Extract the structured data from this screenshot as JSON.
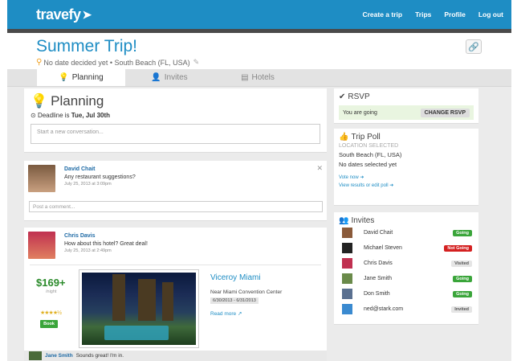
{
  "app": {
    "logo": "travefy"
  },
  "nav": {
    "items": [
      "Create a trip",
      "Trips",
      "Profile",
      "Log out"
    ]
  },
  "trip": {
    "title": "Summer Trip!",
    "subtitle": "No date decided yet • South Beach (FL, USA)"
  },
  "tabs": [
    "Planning",
    "Invites",
    "Hotels"
  ],
  "planning": {
    "heading": "Planning",
    "deadline_prefix": "Deadline is ",
    "deadline": "Tue, Jul 30th",
    "convo_placeholder": "Start a new conversation..."
  },
  "post1": {
    "author": "David Chait",
    "text": "Any restaurant suggestions?",
    "date": "July 25, 2013 at 3:09pm",
    "comment_placeholder": "Post a comment..."
  },
  "post2": {
    "author": "Chris Davis",
    "text": "How about this hotel? Great deal!",
    "date": "July 25, 2013 at 2:49pm"
  },
  "hotel": {
    "price": "$169+",
    "per": "/night",
    "stars": "★★★★½",
    "book": "Book",
    "name": "Viceroy Miami",
    "near": "Near Miami Convention Center",
    "dates": "6/30/2013 - 6/31/2013",
    "more": "Read more"
  },
  "reply": {
    "author": "Jane Smith",
    "text": "Sounds great! I'm in."
  },
  "rsvp": {
    "heading": "RSVP",
    "status": "You are going",
    "change": "CHANGE RSVP"
  },
  "poll": {
    "heading": "Trip Poll",
    "state": "LOCATION SELECTED",
    "location": "South Beach (FL, USA)",
    "dates": "No dates selected yet",
    "vote": "Vote now",
    "results": "View results or edit poll"
  },
  "invites": {
    "heading": "Invites",
    "people": [
      {
        "name": "David Chait",
        "status": "Going",
        "color": "#8a5a3a"
      },
      {
        "name": "Michael Steven",
        "status": "Not Going",
        "color": "#222222"
      },
      {
        "name": "Chris Davis",
        "status": "Visited",
        "color": "#c03050"
      },
      {
        "name": "Jane Smith",
        "status": "Going",
        "color": "#6a8a4a"
      },
      {
        "name": "Don Smith",
        "status": "Going",
        "color": "#5a7090"
      },
      {
        "name": "ned@stark.com",
        "status": "Invited",
        "color": "#3a8ad0"
      }
    ]
  }
}
